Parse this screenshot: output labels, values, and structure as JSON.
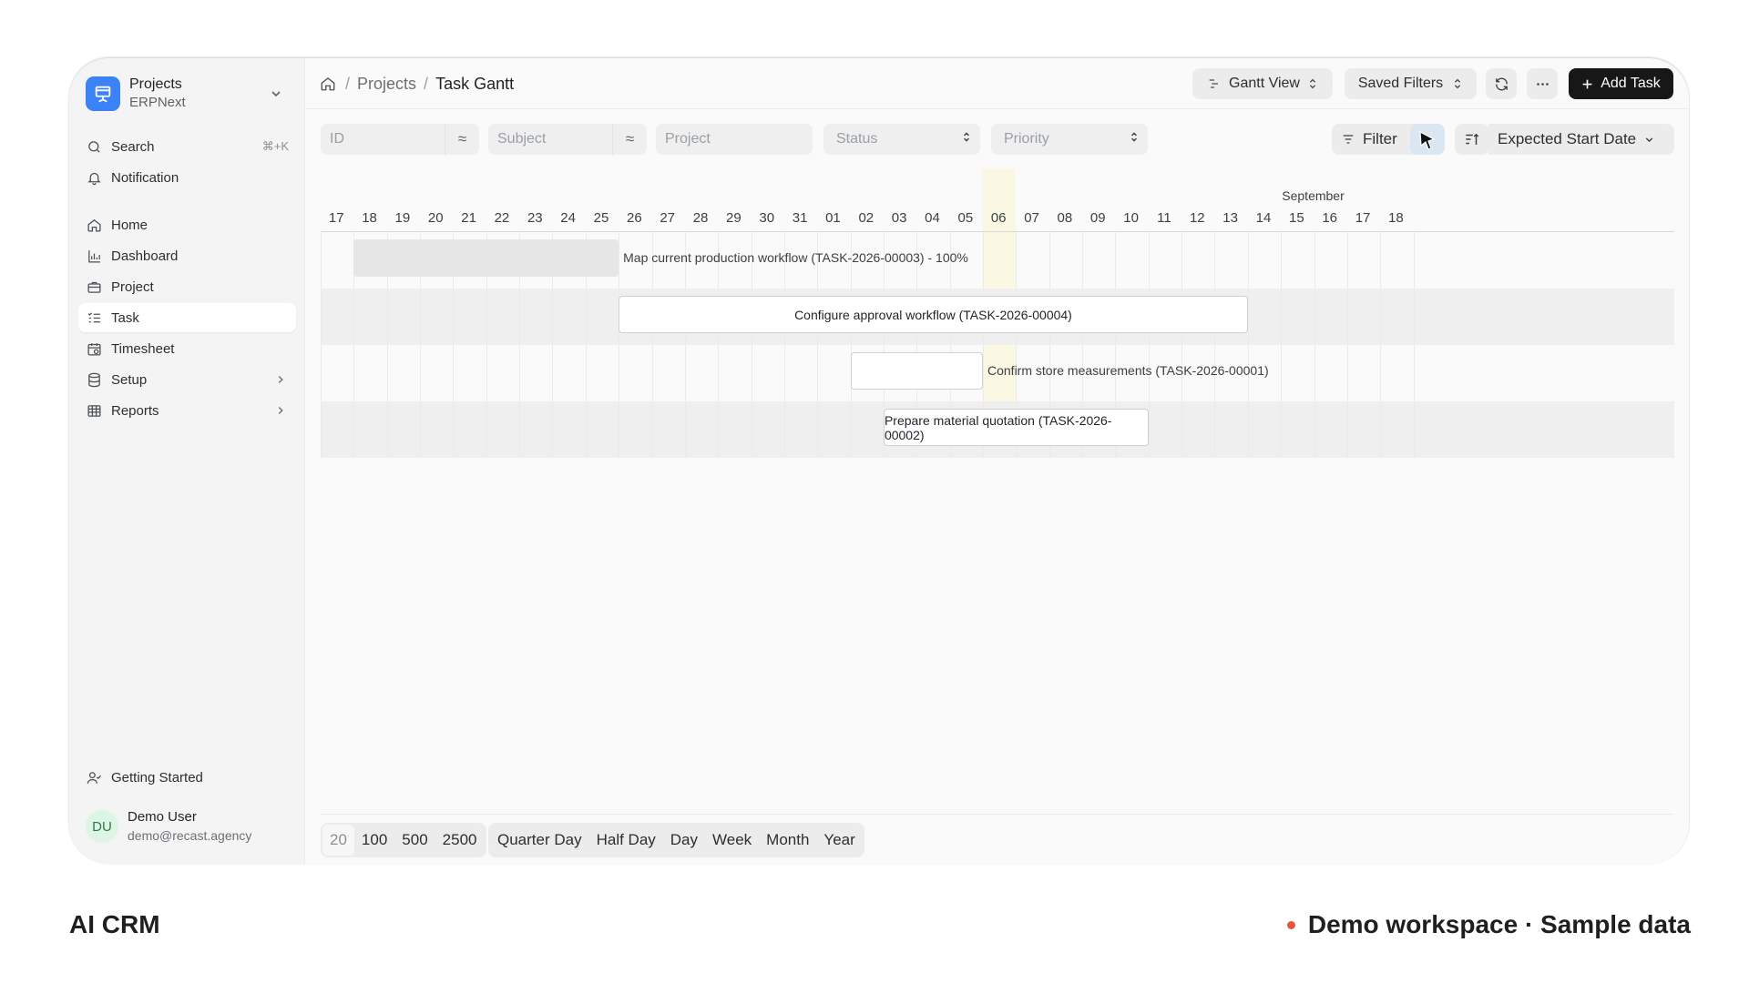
{
  "workspace": {
    "title": "Projects",
    "subtitle": "ERPNext",
    "logo_color": "#3b82f6"
  },
  "sidebar": {
    "search": {
      "label": "Search",
      "shortcut": "⌘+K"
    },
    "notification": {
      "label": "Notification"
    },
    "items": [
      {
        "label": "Home",
        "icon": "home-icon"
      },
      {
        "label": "Dashboard",
        "icon": "bar-chart-icon"
      },
      {
        "label": "Project",
        "icon": "briefcase-icon"
      },
      {
        "label": "Task",
        "icon": "list-check-icon",
        "active": true
      },
      {
        "label": "Timesheet",
        "icon": "calendar-clock-icon"
      },
      {
        "label": "Setup",
        "icon": "database-icon"
      },
      {
        "label": "Reports",
        "icon": "table-icon"
      }
    ],
    "getting_started": "Getting Started",
    "user": {
      "initials": "DU",
      "name": "Demo User",
      "email": "demo@recast.agency"
    }
  },
  "breadcrumb": {
    "parent": "Projects",
    "current": "Task Gantt"
  },
  "toolbar": {
    "view": "Gantt View",
    "saved_filters": "Saved Filters",
    "add_task": "Add Task"
  },
  "filters": {
    "id_placeholder": "ID",
    "subject_placeholder": "Subject",
    "project_placeholder": "Project",
    "status_placeholder": "Status",
    "priority_placeholder": "Priority",
    "like_operator": "≈",
    "filter_label": "Filter",
    "sort_label": "Expected Start Date"
  },
  "gantt": {
    "month_label": "September",
    "days": [
      "17",
      "18",
      "19",
      "20",
      "21",
      "22",
      "23",
      "24",
      "25",
      "26",
      "27",
      "28",
      "29",
      "30",
      "31",
      "01",
      "02",
      "03",
      "04",
      "05",
      "06",
      "07",
      "08",
      "09",
      "10",
      "11",
      "12",
      "13",
      "14",
      "15",
      "16",
      "17",
      "18"
    ],
    "today": "06",
    "tasks": [
      {
        "label": "Map current production workflow (TASK-2026-00003) - 100%",
        "start_day": "18",
        "end_day": "25",
        "progress": 100
      },
      {
        "label": "Configure approval workflow (TASK-2026-00004)",
        "start_day": "26",
        "end_day": "13",
        "progress": 0
      },
      {
        "label": "Confirm store measurements (TASK-2026-00001)",
        "start_day": "02",
        "end_day": "05",
        "progress": 0
      },
      {
        "label": "Prepare material quotation (TASK-2026-00002)",
        "start_day": "03",
        "end_day": "10",
        "progress": 0
      }
    ]
  },
  "page_size": {
    "options": [
      "20",
      "100",
      "500",
      "2500"
    ],
    "selected": "20"
  },
  "view_modes": [
    "Quarter Day",
    "Half Day",
    "Day",
    "Week",
    "Month",
    "Year"
  ],
  "footer": {
    "brand": "AI CRM",
    "demo": "Demo workspace · Sample data",
    "dot_color": "#e8553e"
  }
}
